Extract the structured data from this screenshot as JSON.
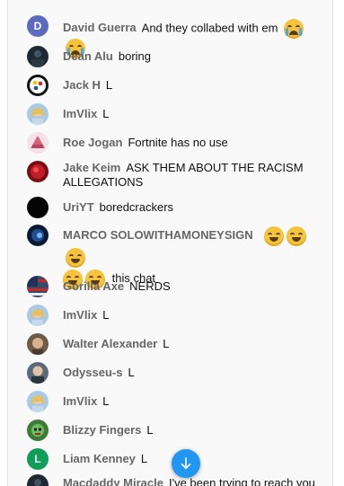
{
  "colors": {
    "accent": "#2196f3",
    "avatar_d": "#5c6bc0",
    "avatar_l": "#0f9d58"
  },
  "messages": [
    {
      "author": "David Guerra",
      "text": "And they collabed with em",
      "avatar": "letter",
      "letter": "D",
      "emoji": [
        "loudly-crying-face",
        "loudly-crying-face"
      ]
    },
    {
      "author": "Dean Alu",
      "text": "boring",
      "avatar": "photo-dark"
    },
    {
      "author": "Jack H",
      "text": "L",
      "avatar": "steelers-logo"
    },
    {
      "author": "ImVlix",
      "text": "L",
      "avatar": "photo-blonde"
    },
    {
      "author": "Roe Jogan",
      "text": "Fortnite has no use",
      "avatar": "photo-pink"
    },
    {
      "author": "Jake Keim",
      "text": "ASK THEM ABOUT THE RACISM ALLEGATIONS",
      "avatar": "photo-red"
    },
    {
      "author": "UriYT",
      "text": "boredcrackers",
      "avatar": "solid-black"
    },
    {
      "author": "MARCO SOLOWITHAMONEYSIGN",
      "text": "this chat",
      "avatar": "photo-blue-dark",
      "emoji": [
        "laughing-face",
        "laughing-face",
        "laughing-face",
        "laughing-face",
        "laughing-face"
      ]
    },
    {
      "author": "Gorilla Axe",
      "text": "NERDS",
      "avatar": "photo-flag"
    },
    {
      "author": "ImVlix",
      "text": "L",
      "avatar": "photo-blonde"
    },
    {
      "author": "Walter Alexander",
      "text": "L",
      "avatar": "photo-face"
    },
    {
      "author": "Odysseu-s",
      "text": "L",
      "avatar": "photo-portrait"
    },
    {
      "author": "ImVlix",
      "text": "L",
      "avatar": "photo-blonde"
    },
    {
      "author": "Blizzy Fingers",
      "text": "L",
      "avatar": "photo-green-character"
    },
    {
      "author": "Liam Kenney",
      "text": "L",
      "avatar": "letter",
      "letter": "L"
    },
    {
      "author": "Macdaddy Miracle",
      "text": "I've been trying to reach you",
      "avatar": "photo-dark"
    }
  ],
  "jump_button": {
    "icon": "arrow-down-icon"
  }
}
